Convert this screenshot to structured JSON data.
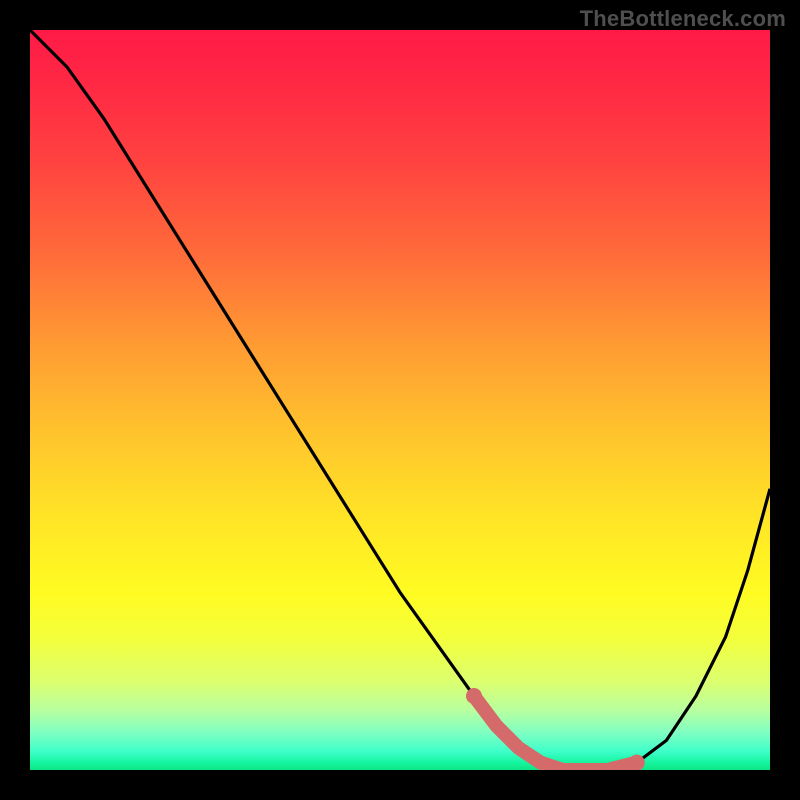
{
  "watermark": "TheBottleneck.com",
  "chart_data": {
    "type": "line",
    "title": "",
    "xlabel": "",
    "ylabel": "",
    "xlim": [
      0,
      100
    ],
    "ylim": [
      0,
      100
    ],
    "series": [
      {
        "name": "bottleneck-curve",
        "x": [
          0,
          5,
          10,
          15,
          20,
          25,
          30,
          35,
          40,
          45,
          50,
          55,
          60,
          63,
          66,
          69,
          72,
          75,
          78,
          82,
          86,
          90,
          94,
          97,
          100
        ],
        "y": [
          100,
          95,
          88,
          80,
          72,
          64,
          56,
          48,
          40,
          32,
          24,
          17,
          10,
          6,
          3,
          1,
          0,
          0,
          0,
          1,
          4,
          10,
          18,
          27,
          38
        ]
      }
    ],
    "highlight_band": {
      "name": "optimal-zone",
      "x_start": 62,
      "x_end": 80,
      "color": "#d46a6a"
    }
  },
  "colors": {
    "curve": "#000000",
    "highlight": "#d46a6a",
    "frame": "#000000"
  }
}
